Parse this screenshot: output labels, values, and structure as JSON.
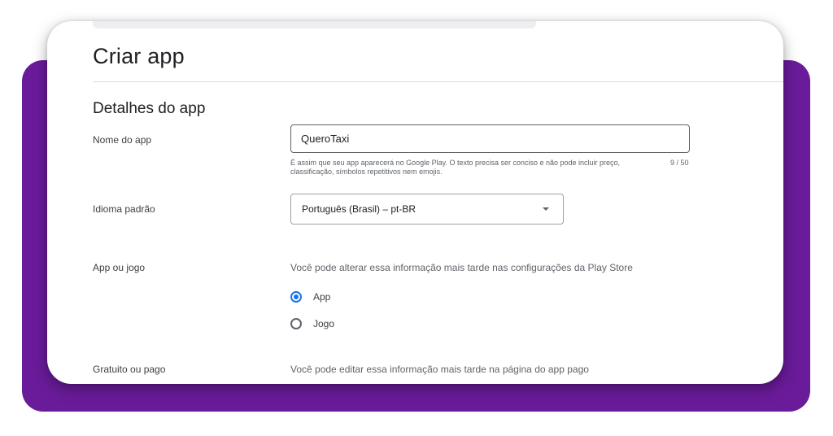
{
  "page": {
    "title": "Criar app"
  },
  "section": {
    "title": "Detalhes do app"
  },
  "app_name": {
    "label": "Nome do app",
    "value": "QueroTaxi",
    "helper": "É assim que seu app aparecerá no Google Play. O texto precisa ser conciso e não pode incluir preço, classificação, símbolos repetitivos nem emojis.",
    "counter": "9 / 50"
  },
  "default_language": {
    "label": "Idioma padrão",
    "selected": "Português (Brasil) – pt-BR"
  },
  "app_or_game": {
    "label": "App ou jogo",
    "description": "Você pode alterar essa informação mais tarde nas configurações da Play Store",
    "options": [
      {
        "label": "App",
        "checked": true
      },
      {
        "label": "Jogo",
        "checked": false
      }
    ]
  },
  "free_or_paid": {
    "label": "Gratuito ou pago",
    "description": "Você pode editar essa informação mais tarde na página do app pago"
  },
  "colors": {
    "accent": "#1a73e8",
    "frame": "#6a1b9a"
  }
}
